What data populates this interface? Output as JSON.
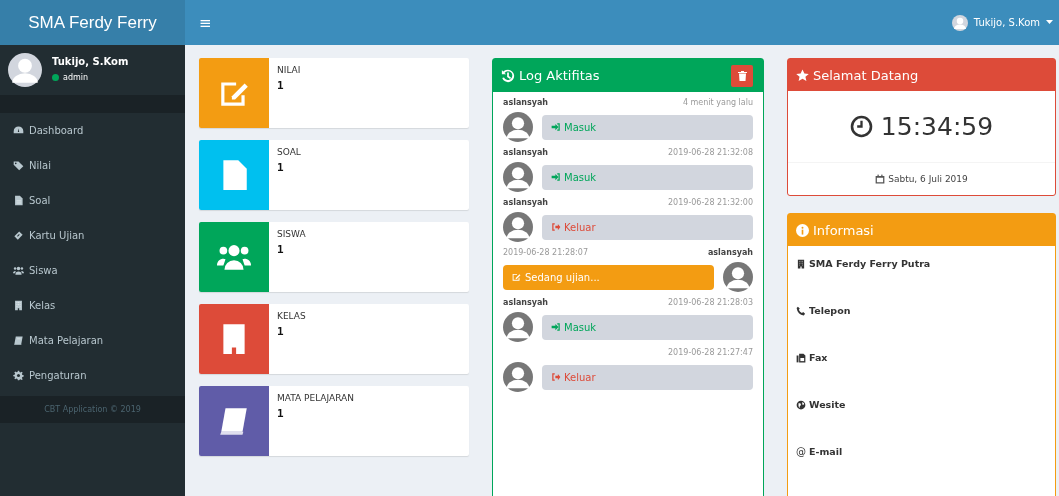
{
  "header": {
    "brand": "SMA Ferdy Ferry",
    "menu_toggle": "≡",
    "user": "Tukijo, S.Kom"
  },
  "sidebar": {
    "user": {
      "name": "Tukijo, S.Kom",
      "role": "admin",
      "online": true
    },
    "items": [
      {
        "label": "Dashboard",
        "kind": "dashboard"
      },
      {
        "label": "Nilai",
        "kind": "tags"
      },
      {
        "label": "Soal",
        "kind": "file"
      },
      {
        "label": "Kartu Ujian",
        "kind": "ticket"
      },
      {
        "label": "Siswa",
        "kind": "users"
      },
      {
        "label": "Kelas",
        "kind": "building"
      },
      {
        "label": "Mata Pelajaran",
        "kind": "book"
      },
      {
        "label": "Pengaturan",
        "kind": "gear"
      }
    ],
    "footer": "CBT Application © 2019"
  },
  "stats": [
    {
      "label": "NILAI",
      "value": "1",
      "kind": "edit",
      "color": "#f39c12"
    },
    {
      "label": "SOAL",
      "value": "1",
      "kind": "file",
      "color": "#00c0ef"
    },
    {
      "label": "SISWA",
      "value": "1",
      "kind": "users",
      "color": "#00a65a"
    },
    {
      "label": "KELAS",
      "value": "1",
      "kind": "building",
      "color": "#dd4b39"
    },
    {
      "label": "MATA PELAJARAN",
      "value": "1",
      "kind": "book",
      "color": "#605ca8"
    }
  ],
  "log": {
    "title": "Log Aktifitas",
    "items": [
      {
        "name": "aslansyah",
        "time": "4 menit yang lalu",
        "kind": "in",
        "text": "Masuk"
      },
      {
        "name": "aslansyah",
        "time": "2019-06-28 21:32:08",
        "kind": "in",
        "text": "Masuk"
      },
      {
        "name": "aslansyah",
        "time": "2019-06-28 21:32:00",
        "kind": "out",
        "text": "Keluar"
      },
      {
        "name": "aslansyah",
        "time": "2019-06-28 21:28:07",
        "kind": "exam",
        "text": "Sedang ujian..."
      },
      {
        "name": "aslansyah",
        "time": "2019-06-28 21:28:03",
        "kind": "in",
        "text": "Masuk"
      },
      {
        "time": "2019-06-28 21:27:47",
        "kind": "out",
        "text": "Keluar"
      }
    ]
  },
  "welcome": {
    "title": "Selamat Datang",
    "clock": "15:34:59",
    "date": "Sabtu, 6 Juli 2019"
  },
  "info": {
    "title": "Informasi",
    "items": [
      {
        "kind": "building",
        "label": "SMA Ferdy Ferry Putra"
      },
      {
        "kind": "phone",
        "label": "Telepon"
      },
      {
        "kind": "fax",
        "label": "Fax"
      },
      {
        "kind": "globe",
        "label": "Wesite"
      },
      {
        "symbol": "@",
        "label": "E-mail"
      }
    ]
  }
}
